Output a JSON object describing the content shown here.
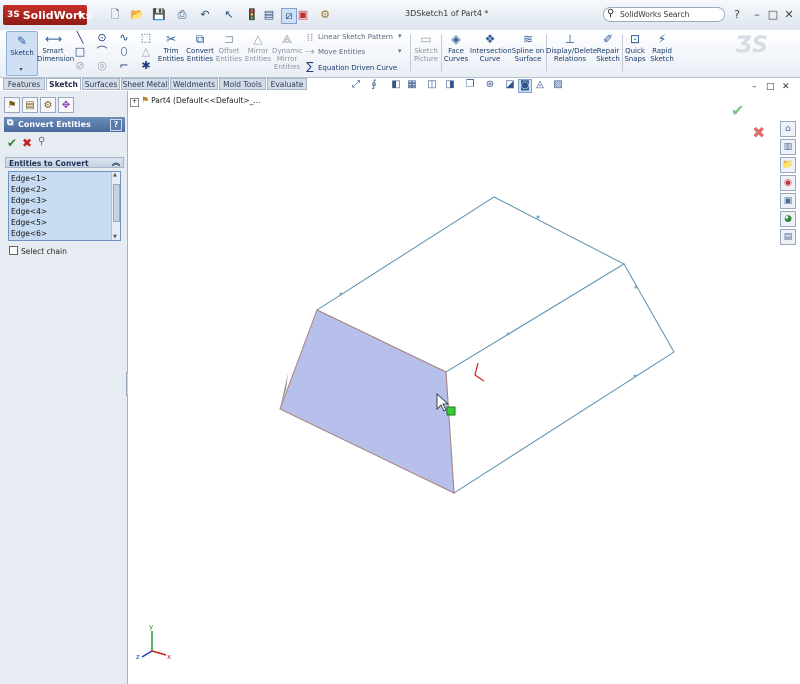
{
  "app": {
    "brand": "SolidWorks",
    "brand_prefix": "3S",
    "document_title": "3DSketch1 of Part4 *",
    "search_placeholder": "SolidWorks Search",
    "help_glyph": "?",
    "window_controls": [
      "–",
      "□",
      "✕"
    ]
  },
  "command_manager": {
    "sketch": "Sketch",
    "smart_dimension": [
      "Smart",
      "Dimension"
    ],
    "trim_entities": [
      "Trim",
      "Entities"
    ],
    "convert_entities": [
      "Convert",
      "Entities"
    ],
    "offset_entities": [
      "Offset",
      "Entities"
    ],
    "mirror_entities": [
      "Mirror",
      "Entities"
    ],
    "dynamic_mirror": [
      "Dynamic",
      "Mirror",
      "Entities"
    ],
    "linear_pattern": "Linear Sketch Pattern",
    "move_entities": "Move Entities",
    "equation_curve": "Equation Driven Curve",
    "sketch_picture": [
      "Sketch",
      "Picture"
    ],
    "face_curves": [
      "Face",
      "Curves"
    ],
    "intersection_curve": [
      "Intersection",
      "Curve"
    ],
    "spline_on_surface": [
      "Spline on",
      "Surface"
    ],
    "display_delete": [
      "Display/Delete",
      "Relations"
    ],
    "repair_sketch": [
      "Repair",
      "Sketch"
    ],
    "quick_snaps": [
      "Quick",
      "Snaps"
    ],
    "rapid_sketch": [
      "Rapid",
      "Sketch"
    ]
  },
  "tabs": [
    "Features",
    "Sketch",
    "Surfaces",
    "Sheet Metal",
    "Weldments",
    "Mold Tools",
    "Evaluate"
  ],
  "active_tab": "Sketch",
  "property_manager": {
    "title": "Convert Entities",
    "help": "?",
    "group_title": "Entities to Convert",
    "entities": [
      "Edge<1>",
      "Edge<2>",
      "Edge<3>",
      "Edge<4>",
      "Edge<5>",
      "Edge<6>"
    ],
    "select_chain": "Select chain"
  },
  "feature_tree": {
    "root": "Part4  (Default<<Default>_..."
  },
  "colors": {
    "selected_face": "#b6c0ea",
    "edge": "#5a8fb0",
    "highlight_edge": "#b08080",
    "accent": "#2e5a96"
  },
  "icons": {
    "ok": "✔",
    "cancel": "✖",
    "pushpin": "⚲"
  }
}
